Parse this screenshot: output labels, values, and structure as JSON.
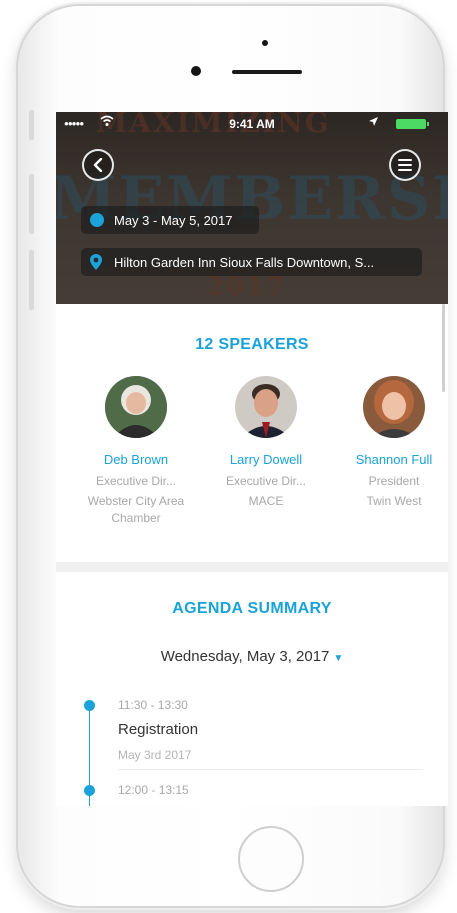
{
  "status_bar": {
    "signal": "●●●●●",
    "time": "9:41 AM"
  },
  "hero": {
    "bg_top": "MAXIMIZING",
    "bg_main": "MEMBERSHIP",
    "bg_bottom": "2017",
    "date_range": "May 3 - May 5, 2017",
    "venue": "Hilton Garden Inn Sioux Falls Downtown, S..."
  },
  "speakers": {
    "title": "12 SPEAKERS",
    "items": [
      {
        "name": "Deb Brown",
        "role": "Executive Dir...",
        "org": "Webster City Area Chamber"
      },
      {
        "name": "Larry Dowell",
        "role": "Executive Dir...",
        "org": "MACE"
      },
      {
        "name": "Shannon Full",
        "role": "President",
        "org": "Twin West"
      }
    ]
  },
  "agenda": {
    "title": "AGENDA SUMMARY",
    "date": "Wednesday, May 3, 2017",
    "items": [
      {
        "time": "11:30 - 13:30",
        "title": "Registration",
        "date": "May 3rd 2017"
      },
      {
        "time": "12:00 - 13:15"
      }
    ]
  },
  "colors": {
    "accent": "#1aa3d9",
    "battery": "#4cd964"
  },
  "icons": [
    "wifi-icon",
    "location-arrow-icon",
    "battery-icon",
    "back-icon",
    "menu-icon",
    "calendar-icon",
    "map-pin-icon",
    "caret-down-icon"
  ]
}
